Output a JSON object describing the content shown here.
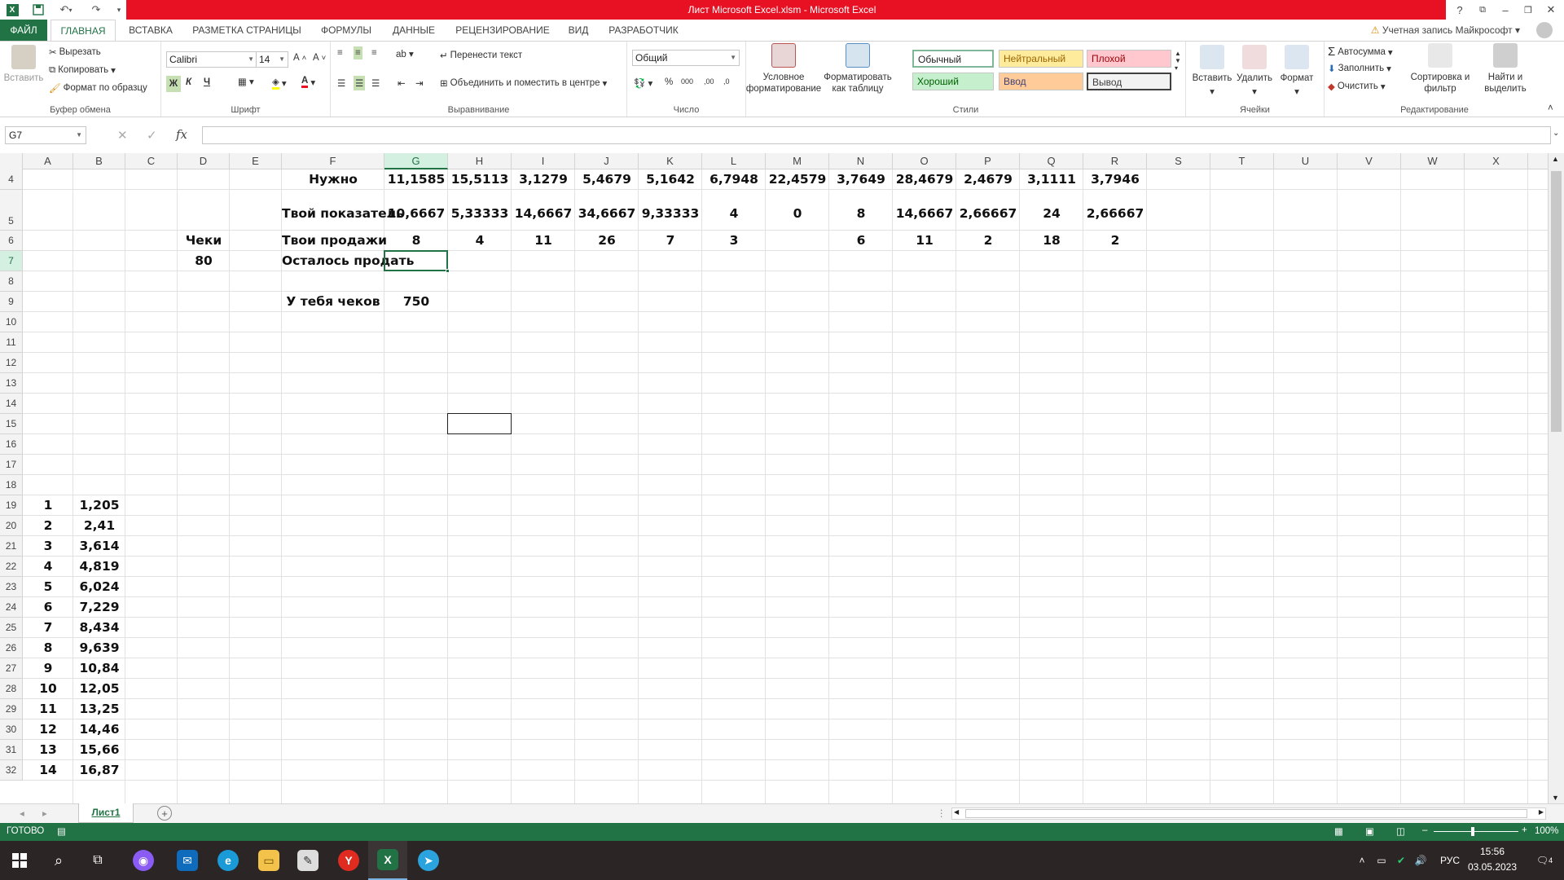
{
  "window": {
    "title": "Лист Microsoft Excel.xlsm - Microsoft Excel"
  },
  "ribbon_tabs": [
    "ФАЙЛ",
    "ГЛАВНАЯ",
    "ВСТАВКА",
    "РАЗМЕТКА СТРАНИЦЫ",
    "ФОРМУЛЫ",
    "ДАННЫЕ",
    "РЕЦЕНЗИРОВАНИЕ",
    "ВИД",
    "РАЗРАБОТЧИК"
  ],
  "account": "Учетная запись Майкрософт",
  "clipboard": {
    "paste": "Вставить",
    "cut": "Вырезать",
    "copy": "Копировать",
    "format_painter": "Формат по образцу",
    "label": "Буфер обмена"
  },
  "font": {
    "name": "Calibri",
    "size": "14",
    "bold": "Ж",
    "italic": "К",
    "underline": "Ч",
    "label": "Шрифт"
  },
  "alignment": {
    "wrap": "Перенести текст",
    "merge": "Объединить и поместить в центре",
    "label": "Выравнивание"
  },
  "number": {
    "format": "Общий",
    "label": "Число"
  },
  "styles": {
    "conditional": "Условное форматирование",
    "as_table": "Форматировать как таблицу",
    "normal": "Обычный",
    "neutral": "Нейтральный",
    "bad": "Плохой",
    "good": "Хороший",
    "input": "Ввод",
    "output": "Вывод",
    "label": "Стили"
  },
  "cells_group": {
    "insert": "Вставить",
    "delete": "Удалить",
    "format": "Формат",
    "label": "Ячейки"
  },
  "editing": {
    "autosum": "Автосумма",
    "fill": "Заполнить",
    "clear": "Очистить",
    "sort": "Сортировка и фильтр",
    "find": "Найти и выделить",
    "label": "Редактирование"
  },
  "formula_bar": {
    "name_box": "G7",
    "fx": "fx",
    "formula": ""
  },
  "columns": [
    "A",
    "B",
    "C",
    "D",
    "E",
    "F",
    "G",
    "H",
    "I",
    "J",
    "K",
    "L",
    "M",
    "N",
    "O",
    "P",
    "Q",
    "R",
    "S",
    "T",
    "U",
    "V",
    "W",
    "X"
  ],
  "rows": [
    "4",
    "5",
    "6",
    "7",
    "8",
    "9",
    "10",
    "11",
    "12",
    "13",
    "14",
    "15",
    "16",
    "17",
    "18",
    "19",
    "20",
    "21",
    "22",
    "23",
    "24",
    "25",
    "26",
    "27",
    "28",
    "29",
    "30",
    "31",
    "32"
  ],
  "sheet": {
    "needed_label": "Нужно",
    "needed": [
      "11,1585",
      "15,5113",
      "3,1279",
      "5,4679",
      "5,1642",
      "6,7948",
      "22,4579",
      "3,7649",
      "28,4679",
      "2,4679",
      "3,1111",
      "3,7946"
    ],
    "indicator_label": "Твой показатель",
    "indicator": [
      "10,6667",
      "5,33333",
      "14,6667",
      "34,6667",
      "9,33333",
      "4",
      "0",
      "8",
      "14,6667",
      "2,66667",
      "24",
      "2,66667"
    ],
    "checks_label": "Чеки",
    "sales_label": "Твои продажи",
    "sales": [
      "8",
      "4",
      "11",
      "26",
      "7",
      "3",
      "",
      "6",
      "11",
      "2",
      "18",
      "2"
    ],
    "checks_value": "80",
    "remaining_label": "Осталось продать",
    "you_have_label": "У тебя чеков",
    "you_have_value": "750",
    "list_a": [
      "1",
      "2",
      "3",
      "4",
      "5",
      "6",
      "7",
      "8",
      "9",
      "10",
      "11",
      "12",
      "13",
      "14"
    ],
    "list_b": [
      "1,205",
      "2,41",
      "3,614",
      "4,819",
      "6,024",
      "7,229",
      "8,434",
      "9,639",
      "10,84",
      "12,05",
      "13,25",
      "14,46",
      "15,66",
      "16,87"
    ]
  },
  "sheet_tab": "Лист1",
  "status": {
    "ready": "ГОТОВО",
    "zoom": "100%"
  },
  "taskbar": {
    "lang": "РУС",
    "time": "15:56",
    "date": "03.05.2023",
    "notif": "4"
  },
  "colors": {
    "excel_green": "#217346",
    "title_red": "#e81123",
    "selection": "#217346"
  }
}
